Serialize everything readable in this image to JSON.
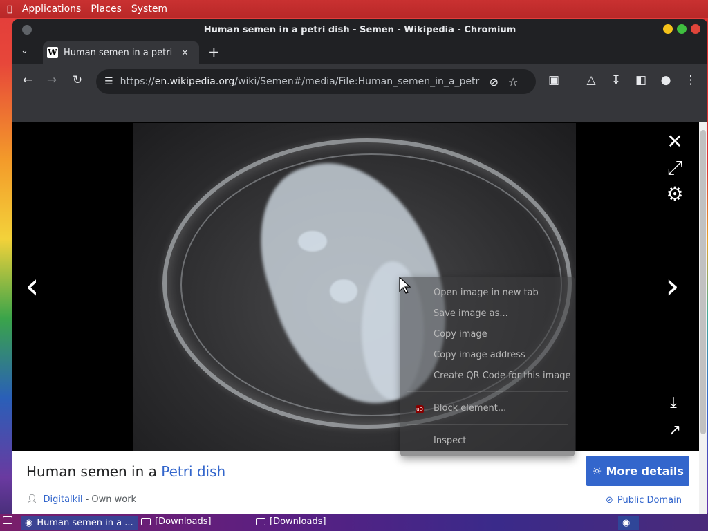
{
  "top_panel": {
    "menus": [
      "Applications",
      "Places",
      "System"
    ]
  },
  "window": {
    "title": "Human semen in a petri dish - Semen - Wikipedia - Chromium"
  },
  "tab": {
    "favicon": "W",
    "title": "Human semen in a petri dish",
    "close": "×"
  },
  "toolbar": {
    "url_host": "en.wikipedia.org",
    "url_prefix": "https://",
    "url_path": "/wiki/Semen#/media/File:Human_semen_in_a_petri_dish.jpg"
  },
  "context_menu": {
    "items": [
      "Open image in new tab",
      "Save image as...",
      "Copy image",
      "Copy image address",
      "Create QR Code for this image"
    ],
    "extension_badge": "uD",
    "extension_item": "Block element...",
    "inspect": "Inspect"
  },
  "caption": {
    "title_prefix": "Human semen in a ",
    "title_link": "Petri dish",
    "more_details": "More details",
    "author": "Digitalkil",
    "author_suffix": " - Own work",
    "license": "Public Domain"
  },
  "taskbar": {
    "items": [
      "Human semen in a ...",
      "[Downloads]",
      "[Downloads]"
    ]
  },
  "colors": {
    "link": "#3366cc",
    "button": "#3366cc"
  }
}
